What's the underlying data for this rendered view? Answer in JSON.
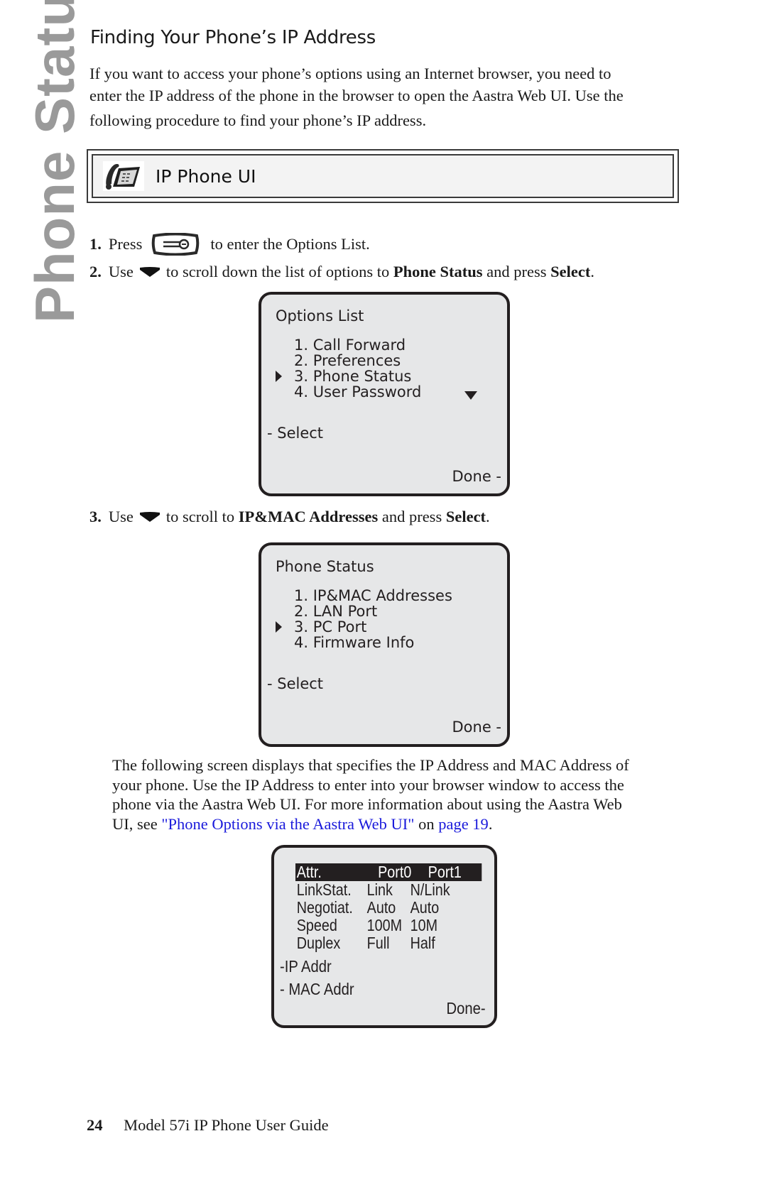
{
  "side_tab": "Phone Status",
  "heading": "Finding Your Phone’s IP Address",
  "intro": {
    "line1": "If you want to access your phone’s options using an Internet browser, you need to",
    "line2": "enter the IP address of the phone in the browser to open the Aastra Web UI. Use the",
    "line3": "following procedure to find your phone’s IP address."
  },
  "ui_box": {
    "icon": "desk-phone-icon",
    "title": "IP Phone UI"
  },
  "steps": [
    {
      "num": "1.",
      "pre": "Press",
      "icon": "options-key-icon",
      "post": "to enter the Options List."
    },
    {
      "num": "2.",
      "pre": "Use",
      "icon": "down-arrow-key-icon",
      "mid": "to scroll down the list of options to",
      "bold1": "Phone Status",
      "mid2": "and press",
      "bold2": "Select",
      "end": "."
    },
    {
      "num": "3.",
      "pre": "Use",
      "icon": "down-arrow-key-icon",
      "mid": "to scroll to",
      "bold1": "IP&MAC Addresses",
      "mid2": "and press",
      "bold2": "Select",
      "end": "."
    }
  ],
  "screen_options": {
    "title": "Options List",
    "items": [
      "1. Call Forward",
      "2. Preferences",
      "3. Phone Status",
      "4. User Password"
    ],
    "selected_index": 2,
    "left_softkey": "- Select",
    "right_softkey": "Done -"
  },
  "screen_status": {
    "title": "Phone Status",
    "items": [
      "1. IP&MAC Addresses",
      "2. LAN Port",
      "3. PC Port",
      "4. Firmware Info"
    ],
    "selected_index": 2,
    "left_softkey": "- Select",
    "right_softkey": "Done -"
  },
  "para2": {
    "line1": "The following screen displays that specifies the IP Address and MAC Address of",
    "line2": "your phone. Use the IP Address to enter into your browser window to access the",
    "line3": "phone via the Aastra Web UI. For more information about using the Aastra Web",
    "line4_pre": "UI, see ",
    "link1": "\"Phone Options via the Aastra Web UI\"",
    "line4_mid": " on ",
    "link2": "page 19",
    "line4_end": "."
  },
  "screen_ports": {
    "header": [
      "Attr.",
      "Port0",
      "Port1"
    ],
    "rows": [
      [
        "LinkStat.",
        "Link",
        "N/Link"
      ],
      [
        "Negotiat.",
        "Auto",
        "Auto"
      ],
      [
        "Speed",
        "100M",
        "10M"
      ],
      [
        "Duplex",
        "Full",
        "Half"
      ]
    ],
    "softkey1": "-IP Addr",
    "softkey2": "- MAC Addr",
    "done": "Done-"
  },
  "footer": {
    "page": "24",
    "title": "Model 57i IP Phone User Guide"
  },
  "colors": {
    "side_tab": "#9a9a9a",
    "link": "#1a1adb",
    "lcd_bg": "#e6e7e8",
    "lcd_border": "#231f20"
  }
}
